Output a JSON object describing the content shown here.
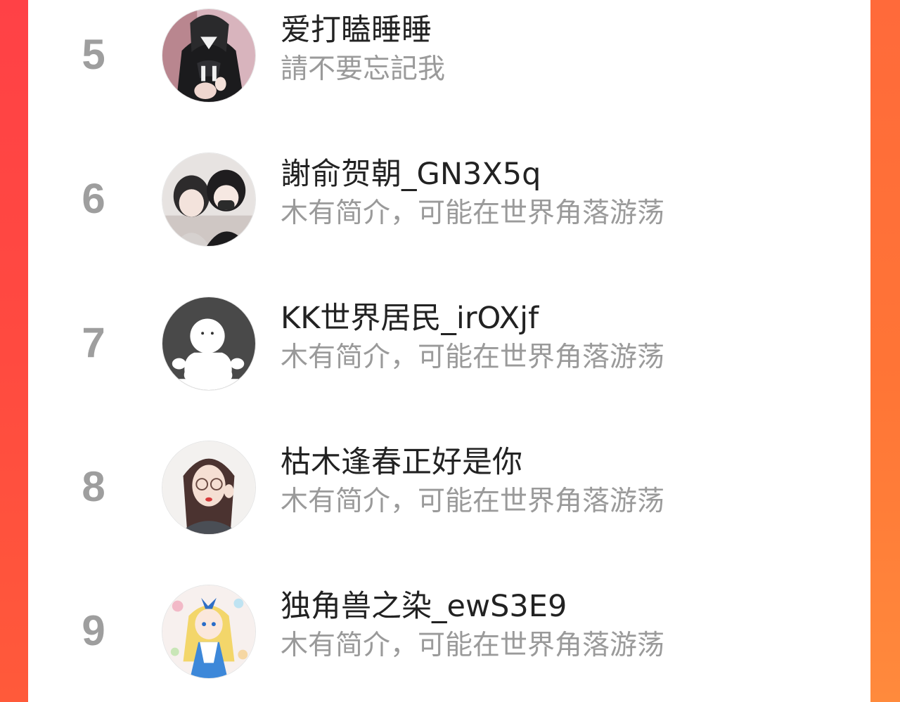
{
  "ranking": {
    "rows": [
      {
        "rank": "5",
        "name": "爱打瞌睡睡",
        "bio": "請不要忘記我",
        "avatar_icon": "avatar-dark-uniform-girl-icon"
      },
      {
        "rank": "6",
        "name": "謝俞贺朝_GN3X5q",
        "bio": "木有简介，可能在世界角落游荡",
        "avatar_icon": "avatar-two-anime-boys-icon"
      },
      {
        "rank": "7",
        "name": "KK世界居民_irOXjf",
        "bio": "木有简介，可能在世界角落游荡",
        "avatar_icon": "avatar-default-ghost-icon"
      },
      {
        "rank": "8",
        "name": "枯木逢春正好是你",
        "bio": "木有简介，可能在世界角落游荡",
        "avatar_icon": "avatar-girl-glasses-icon"
      },
      {
        "rank": "9",
        "name": "独角兽之染_ewS3E9",
        "bio": "木有简介，可能在世界角落游荡",
        "avatar_icon": "avatar-alice-anime-icon"
      }
    ]
  },
  "colors": {
    "accent_left": "#ff4146",
    "accent_right": "#ff7a38",
    "rank_gray": "#9e9e9e",
    "name_text": "#222222",
    "bio_text": "#9a9a9a"
  }
}
